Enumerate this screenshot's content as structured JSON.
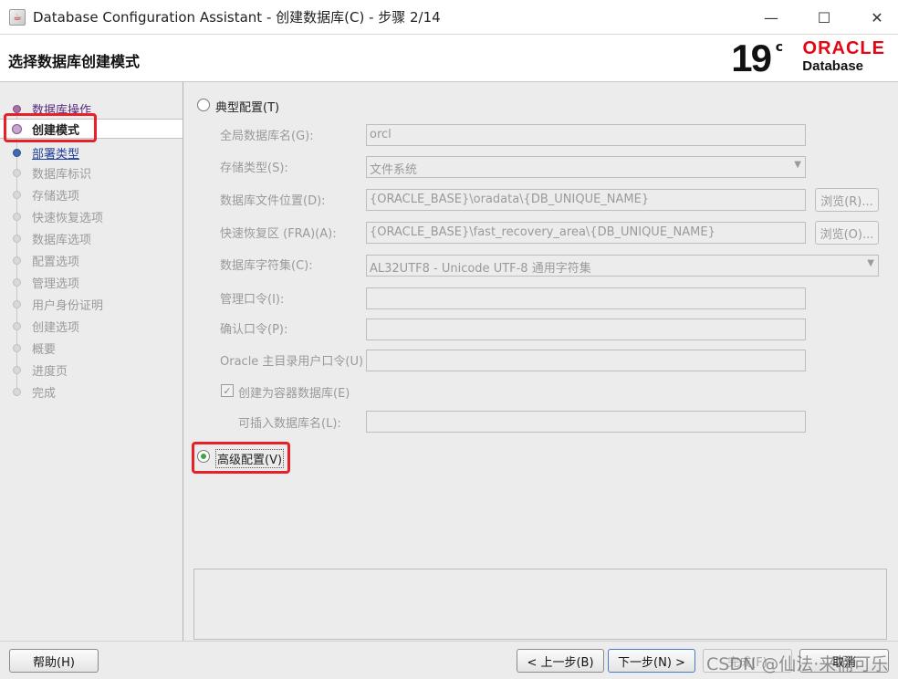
{
  "window": {
    "title": "Database Configuration Assistant - 创建数据库(C) - 步骤 2/14",
    "app_icon": "java-cup-icon",
    "controls": [
      "minimize-icon",
      "maximize-icon",
      "close-icon"
    ]
  },
  "header": {
    "title": "选择数据库创建模式",
    "logo": {
      "version": "19",
      "version_sup": "c",
      "brand": "ORACLE",
      "product": "Database",
      "brand_color": "#e30613"
    }
  },
  "nav": {
    "items": [
      {
        "label": "数据库操作",
        "state": "done"
      },
      {
        "label": "创建模式",
        "state": "current"
      },
      {
        "label": "部署类型",
        "state": "next"
      },
      {
        "label": "数据库标识",
        "state": "disabled"
      },
      {
        "label": "存储选项",
        "state": "disabled"
      },
      {
        "label": "快速恢复选项",
        "state": "disabled"
      },
      {
        "label": "数据库选项",
        "state": "disabled"
      },
      {
        "label": "配置选项",
        "state": "disabled"
      },
      {
        "label": "管理选项",
        "state": "disabled"
      },
      {
        "label": "用户身份证明",
        "state": "disabled"
      },
      {
        "label": "创建选项",
        "state": "disabled"
      },
      {
        "label": "概要",
        "state": "disabled"
      },
      {
        "label": "进度页",
        "state": "disabled"
      },
      {
        "label": "完成",
        "state": "disabled"
      }
    ]
  },
  "main": {
    "typical": {
      "label": "典型配置(T)",
      "selected": false
    },
    "fields": {
      "global_db_name": {
        "label": "全局数据库名(G):",
        "value": "orcl"
      },
      "storage_type": {
        "label": "存储类型(S):",
        "value": "文件系统"
      },
      "db_file_location": {
        "label": "数据库文件位置(D):",
        "value": "{ORACLE_BASE}\\oradata\\{DB_UNIQUE_NAME}",
        "browse": "浏览(R)..."
      },
      "fra": {
        "label": "快速恢复区 (FRA)(A):",
        "value": "{ORACLE_BASE}\\fast_recovery_area\\{DB_UNIQUE_NAME}",
        "browse": "浏览(O)..."
      },
      "charset": {
        "label": "数据库字符集(C):",
        "value": "AL32UTF8 - Unicode UTF-8 通用字符集"
      },
      "admin_password": {
        "label": "管理口令(I):",
        "value": ""
      },
      "confirm_password": {
        "label": "确认口令(P):",
        "value": ""
      },
      "oracle_home_password": {
        "label": "Oracle 主目录用户口令(U)",
        "value": ""
      },
      "container_db": {
        "label": "创建为容器数据库(E)",
        "checked": true
      },
      "pdb_name": {
        "label": "可插入数据库名(L):",
        "value": ""
      }
    },
    "advanced": {
      "label": "高级配置(V)",
      "selected": true
    }
  },
  "footer": {
    "help": "帮助(H)",
    "back": "< 上一步(B)",
    "next": "下一步(N) >",
    "finish": "完成(F)",
    "cancel": "取消",
    "watermark": "CSDN @仙法·来桶可乐"
  },
  "colors": {
    "highlight_box": "#e8202a",
    "selected_radio": "#3ea83e"
  }
}
